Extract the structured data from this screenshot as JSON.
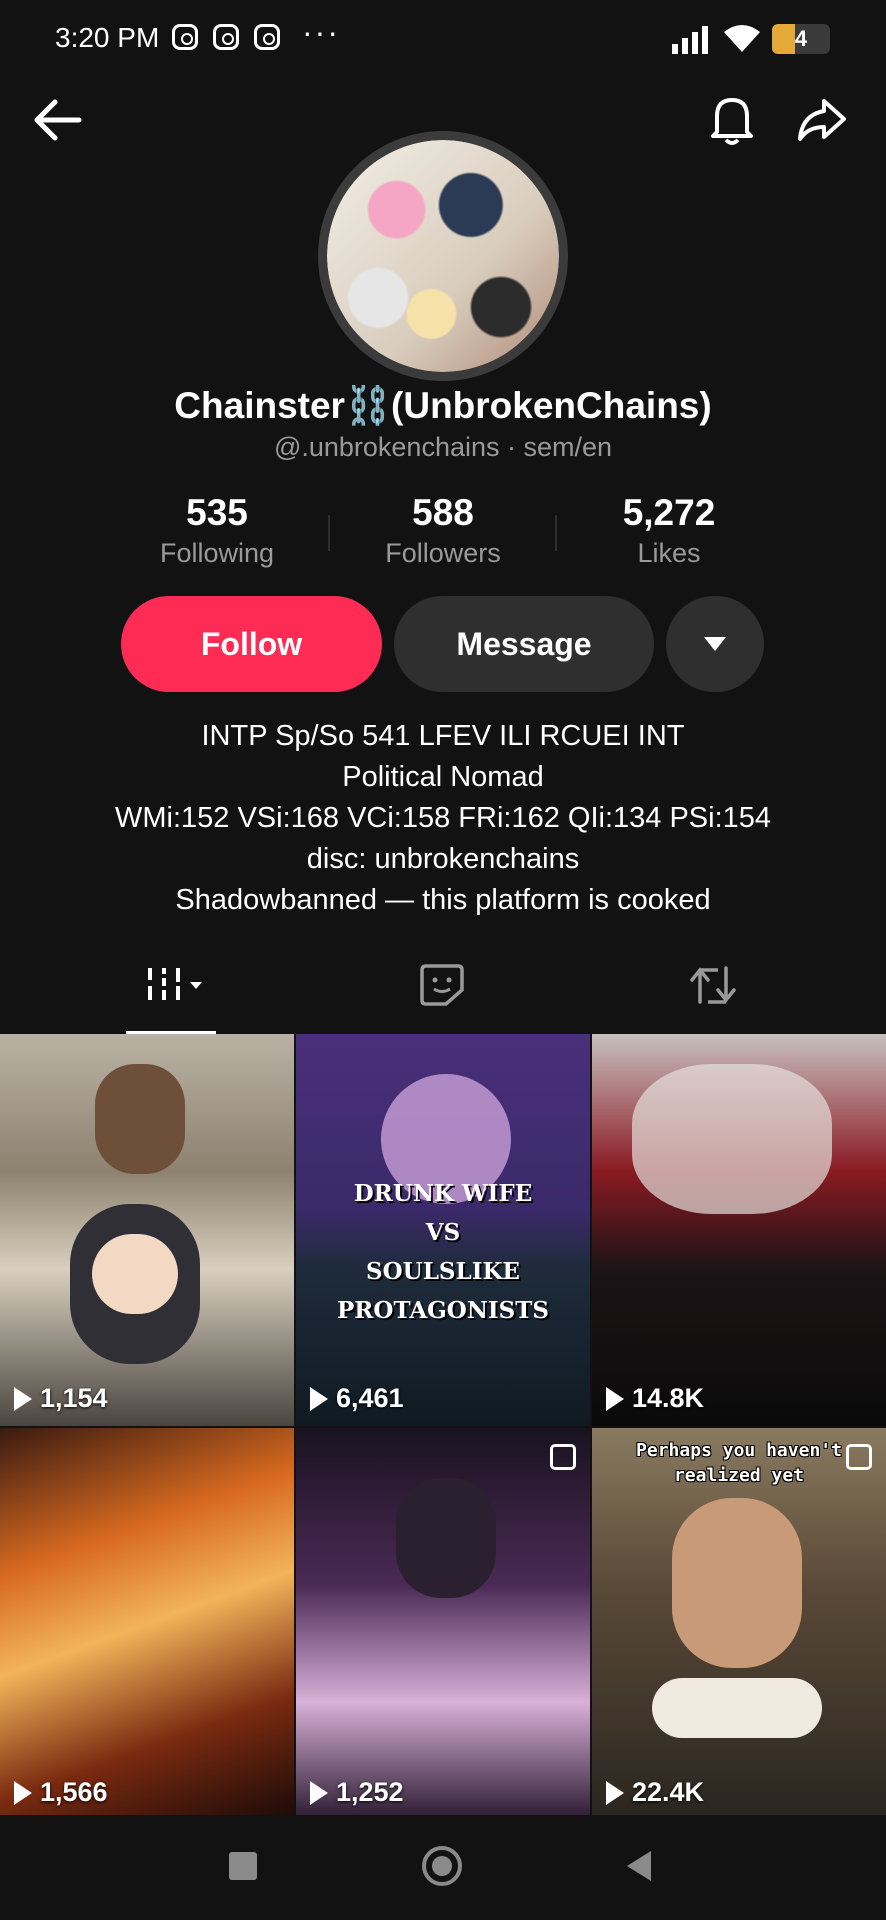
{
  "status_bar": {
    "time": "3:20 PM",
    "dots": "···",
    "battery": "4",
    "battery_level": 0.4
  },
  "profile": {
    "display_name": "Chainster⛓️(UnbrokenChains)",
    "handle": "@.unbrokenchains · sem/en",
    "stats": [
      {
        "value": "535",
        "label": "Following"
      },
      {
        "value": "588",
        "label": "Followers"
      },
      {
        "value": "5,272",
        "label": "Likes"
      }
    ],
    "follow_label": "Follow",
    "message_label": "Message",
    "bio": [
      "INTP Sp/So 541 LFEV ILI RCUEI INT",
      "Political Nomad",
      "WMi:152 VSi:168 VCi:158 FRi:162 QIi:134 PSi:154",
      "disc: unbrokenchains",
      "Shadowbanned — this platform is cooked"
    ]
  },
  "tabs": [
    "videos-grid-icon",
    "liked-icon",
    "repost-icon"
  ],
  "videos": [
    {
      "views": "1,154",
      "overlay": ""
    },
    {
      "views": "6,461",
      "overlay": "DRUNK WIFE\nVS\nSOULSLIKE\nPROTAGONISTS"
    },
    {
      "views": "14.8K",
      "overlay": ""
    },
    {
      "views": "1,566",
      "overlay": ""
    },
    {
      "views": "1,252",
      "overlay": ""
    },
    {
      "views": "22.4K",
      "overlay": "Perhaps you haven't\nrealized yet"
    }
  ],
  "colors": {
    "accent": "#fe2c55",
    "background": "#121212",
    "secondary_button": "#2f2f2f"
  }
}
